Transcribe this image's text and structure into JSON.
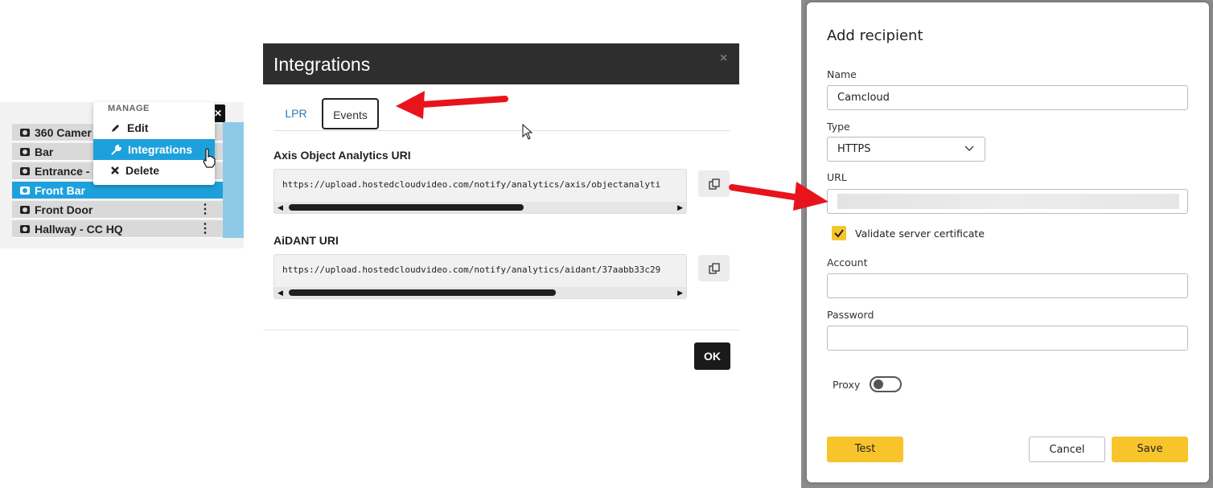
{
  "camera_list": {
    "items": [
      {
        "label": "360 Camer",
        "selected": false,
        "has_menu": false
      },
      {
        "label": "Bar",
        "selected": false,
        "has_menu": false
      },
      {
        "label": "Entrance -",
        "selected": false,
        "has_menu": false
      },
      {
        "label": "Front Bar",
        "selected": true,
        "has_menu": false
      },
      {
        "label": "Front Door",
        "selected": false,
        "has_menu": true
      },
      {
        "label": "Hallway - CC HQ",
        "selected": false,
        "has_menu": true
      }
    ],
    "row_icon": "camera-icon"
  },
  "context_menu": {
    "header": "MANAGE",
    "items": [
      {
        "label": "Edit",
        "icon": "pencil-icon",
        "highlighted": false
      },
      {
        "label": "Integrations",
        "icon": "wrench-icon",
        "highlighted": true
      },
      {
        "label": "Delete",
        "icon": "x-icon",
        "highlighted": false
      }
    ]
  },
  "integrations_modal": {
    "title": "Integrations",
    "close_symbol": "×",
    "tabs": [
      {
        "label": "LPR",
        "active": false
      },
      {
        "label": "Events",
        "active": true
      }
    ],
    "fields": [
      {
        "label": "Axis Object Analytics URI",
        "value": "https://upload.hostedcloudvideo.com/notify/analytics/axis/objectanalyti"
      },
      {
        "label": "AiDANT URI",
        "value": "https://upload.hostedcloudvideo.com/notify/analytics/aidant/37aabb33c29"
      }
    ],
    "scroll_left_symbol": "◀",
    "scroll_right_symbol": "▶",
    "ok_label": "OK"
  },
  "add_recipient": {
    "title": "Add recipient",
    "name_label": "Name",
    "name_value": "Camcloud",
    "type_label": "Type",
    "type_value": "HTTPS",
    "url_label": "URL",
    "validate_label": "Validate server certificate",
    "validate_checked": true,
    "account_label": "Account",
    "account_value": "",
    "password_label": "Password",
    "password_value": "",
    "proxy_label": "Proxy",
    "proxy_enabled": false,
    "test_label": "Test",
    "cancel_label": "Cancel",
    "save_label": "Save",
    "accent_color": "#f7c52b"
  },
  "colors": {
    "selection_blue": "#1ea0dc",
    "annotation_red": "#e8141c",
    "modal_header": "#2e2e2e"
  }
}
